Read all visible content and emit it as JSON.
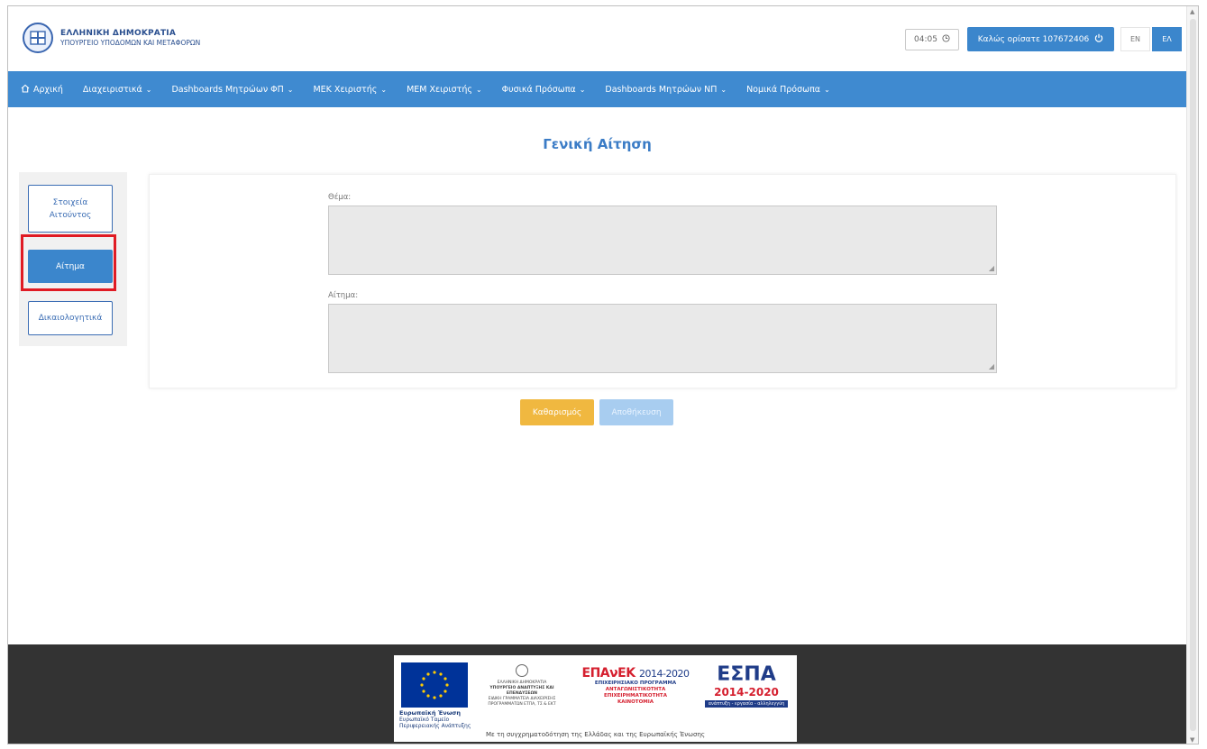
{
  "header": {
    "org_line1": "ΕΛΛΗΝΙΚΗ ΔΗΜΟΚΡΑΤΙΑ",
    "org_line2": "ΥΠΟΥΡΓΕΙΟ ΥΠΟΔΟΜΩΝ ΚΑΙ ΜΕΤΑΦΟΡΩΝ",
    "timer": "04:05",
    "welcome": "Καλώς ορίσατε 107672406",
    "lang_en": "EN",
    "lang_el": "ΕΛ"
  },
  "nav": {
    "items": [
      {
        "label": "Αρχική",
        "dropdown": false
      },
      {
        "label": "Διαχειριστικά",
        "dropdown": true
      },
      {
        "label": "Dashboards Μητρώων ΦΠ",
        "dropdown": true
      },
      {
        "label": "ΜΕΚ Χειριστής",
        "dropdown": true
      },
      {
        "label": "ΜΕΜ Χειριστής",
        "dropdown": true
      },
      {
        "label": "Φυσικά Πρόσωπα",
        "dropdown": true
      },
      {
        "label": "Dashboards Μητρώων ΝΠ",
        "dropdown": true
      },
      {
        "label": "Νομικά Πρόσωπα",
        "dropdown": true
      }
    ]
  },
  "page": {
    "title": "Γενική Αίτηση"
  },
  "sidebar": {
    "items": [
      {
        "label": "Στοιχεία Αιτούντος",
        "active": false
      },
      {
        "label": "Αίτημα",
        "active": true
      },
      {
        "label": "Δικαιολογητικά",
        "active": false
      }
    ]
  },
  "form": {
    "subject_label": "Θέμα:",
    "subject_value": "",
    "request_label": "Αίτημα:",
    "request_value": ""
  },
  "actions": {
    "clear_label": "Καθαρισμός",
    "save_label": "Αποθήκευση"
  },
  "footer": {
    "eu_title": "Ευρωπαϊκή Ένωση",
    "eu_sub": "Ευρωπαϊκό Ταμείο Περιφερειακής Ανάπτυξης",
    "ministry_line1": "ΕΛΛΗΝΙΚΗ ΔΗΜΟΚΡΑΤΙΑ",
    "ministry_line2": "ΥΠΟΥΡΓΕΙΟ ΑΝΑΠΤΥΞΗΣ ΚΑΙ ΕΠΕΝΔΥΣΕΩΝ",
    "ministry_line3": "ΕΙΔΙΚΗ ΓΡΑΜΜΑΤΕΙΑ ΔΙΑΧΕΙΡΙΣΗΣ ΠΡΟΓΡΑΜΜΑΤΩΝ ΕΤΠΑ, ΤΣ & ΕΚΤ",
    "epanek_title": "ΕΠΑνΕΚ",
    "epanek_years": "2014-2020",
    "epanek_sub1": "ΕΠΙΧΕΙΡΗΣΙΑΚΟ ΠΡΟΓΡΑΜΜΑ",
    "epanek_sub2": "ΑΝΤΑΓΩΝΙΣΤΙΚΟΤΗΤΑ",
    "epanek_sub3": "ΕΠΙΧΕΙΡΗΜΑΤΙΚΟΤΗΤΑ",
    "epanek_sub4": "ΚΑΙΝΟΤΟΜΙΑ",
    "espa_title": "ΕΣΠΑ",
    "espa_years": "2014-2020",
    "espa_tagline": "ανάπτυξη - εργασία - αλληλεγγύη",
    "cofund": "Με τη συγχρηματοδότηση της Ελλάδας και της Ευρωπαϊκής Ένωσης"
  }
}
